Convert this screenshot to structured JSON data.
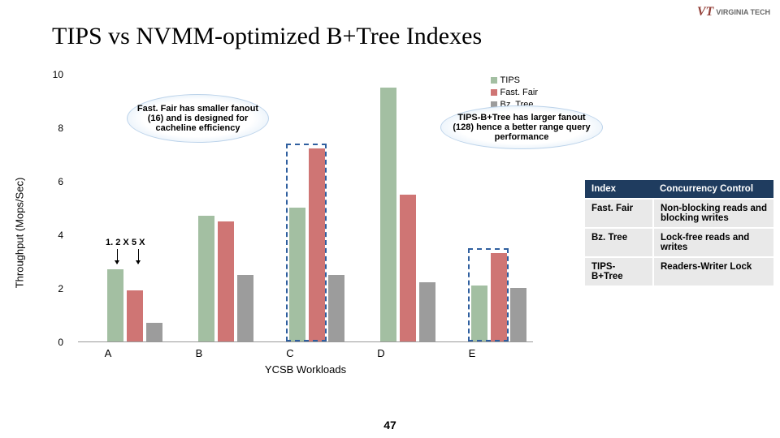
{
  "title": "TIPS vs NVMM-optimized B+Tree Indexes",
  "logo": {
    "mark": "VT",
    "text": "VIRGINIA TECH"
  },
  "page_number": "47",
  "chart_data": {
    "type": "bar",
    "ylabel": "Throughput (Mops/Sec)",
    "xlabel": "YCSB Workloads",
    "ylim": [
      0,
      10
    ],
    "yticks": [
      0,
      2,
      4,
      6,
      8,
      10
    ],
    "categories": [
      "A",
      "B",
      "C",
      "D",
      "E"
    ],
    "series": [
      {
        "name": "TIPS",
        "values": [
          2.7,
          4.7,
          5.0,
          9.5,
          2.1
        ]
      },
      {
        "name": "Fast. Fair",
        "values": [
          1.9,
          4.5,
          7.2,
          5.5,
          3.3
        ]
      },
      {
        "name": "Bz. Tree",
        "values": [
          0.7,
          2.5,
          2.5,
          2.2,
          2.0
        ]
      }
    ],
    "legend": {
      "tips": "TIPS",
      "ff": "Fast. Fair",
      "bz": "Bz. Tree"
    }
  },
  "annotations": {
    "ann1": "1. 2 X",
    "ann2": "5 X",
    "callout1": "Fast. Fair has smaller fanout (16) and is designed for cacheline efficiency",
    "callout2": "TIPS-B+Tree has larger fanout (128) hence a better range query performance"
  },
  "table": {
    "head": {
      "c1": "Index",
      "c2": "Concurrency Control"
    },
    "rows": [
      {
        "c1": "Fast. Fair",
        "c2": "Non-blocking reads and blocking writes"
      },
      {
        "c1": "Bz. Tree",
        "c2": "Lock-free reads and writes"
      },
      {
        "c1": "TIPS-B+Tree",
        "c2": "Readers-Writer Lock"
      }
    ]
  }
}
